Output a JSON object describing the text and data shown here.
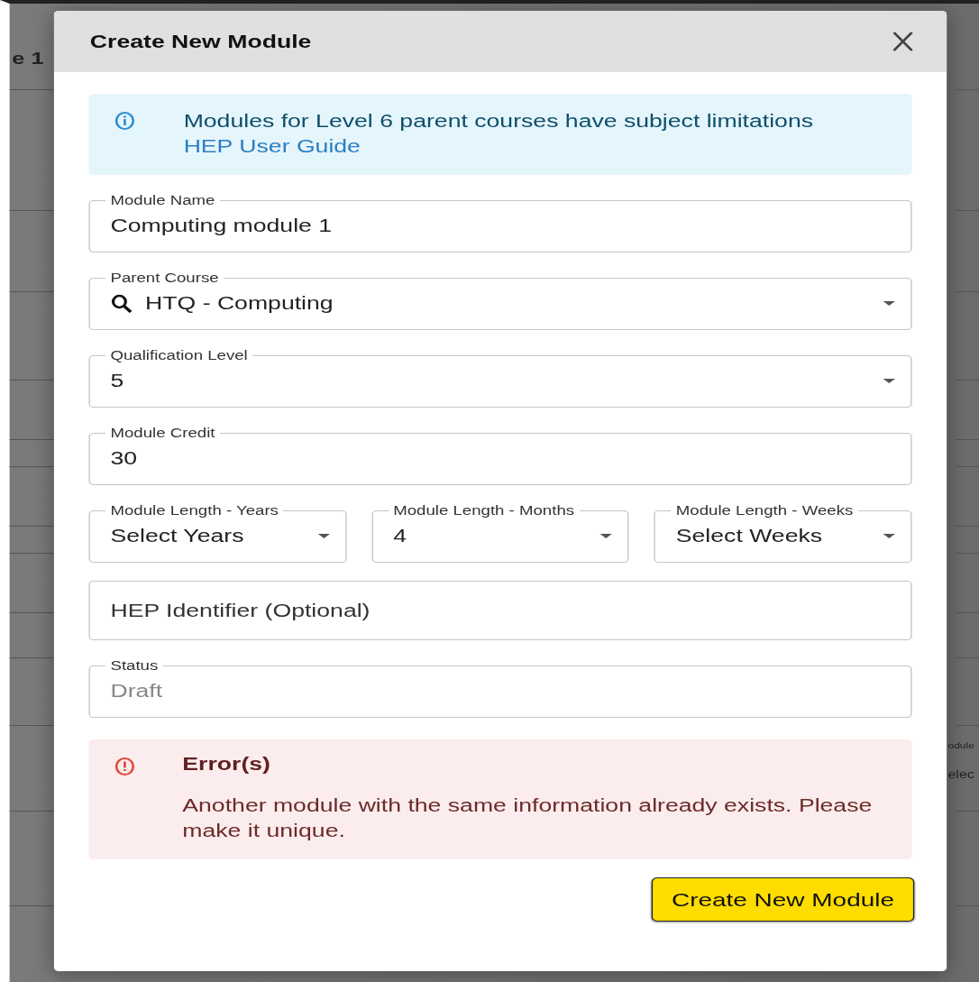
{
  "backdrop": {
    "texts": [
      "e 1",
      "odule",
      "elec"
    ]
  },
  "dialog": {
    "title": "Create New Module",
    "info": {
      "text": "Modules for Level 6 parent courses have subject limitations",
      "link": "HEP User Guide"
    },
    "fields": [
      {
        "kind": "text",
        "label": "Module Name",
        "value": "Computing module 1"
      },
      {
        "kind": "search-select",
        "label": "Parent Course",
        "value": "HTQ - Computing"
      },
      {
        "kind": "select",
        "label": "Qualification Level",
        "value": "5"
      },
      {
        "kind": "text",
        "label": "Module Credit",
        "value": "30"
      },
      {
        "kind": "row",
        "children": [
          {
            "kind": "select",
            "label": "Module Length - Years",
            "value": "Select Years"
          },
          {
            "kind": "select",
            "label": "Module Length - Months",
            "value": "4"
          },
          {
            "kind": "select",
            "label": "Module Length - Weeks",
            "value": "Select Weeks"
          }
        ]
      },
      {
        "kind": "text",
        "placeholder": "HEP Identifier (Optional)"
      },
      {
        "kind": "text",
        "label": "Status",
        "value": "Draft",
        "disabled": true
      }
    ],
    "error": {
      "title": "Error(s)",
      "message": "Another module with the same information already exists. Please make it unique."
    },
    "button": "Create New Module"
  }
}
